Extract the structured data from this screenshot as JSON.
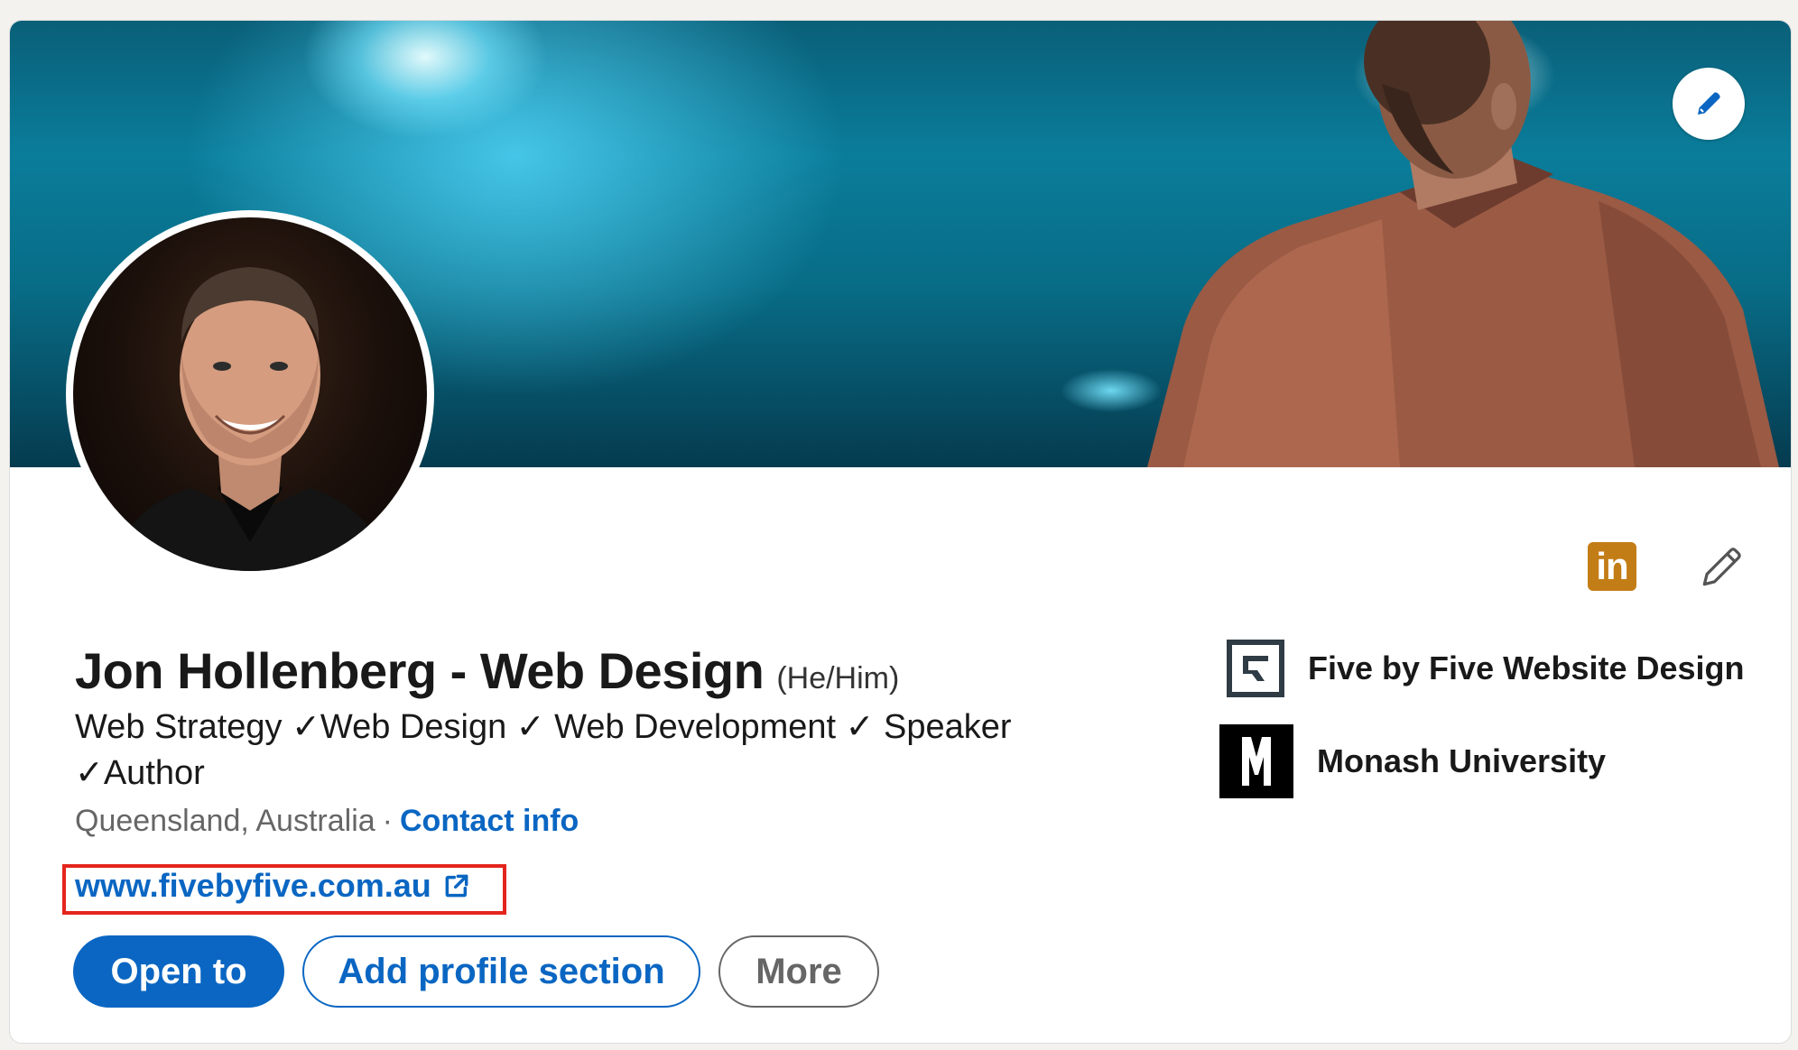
{
  "profile": {
    "name": "Jon Hollenberg - Web Design",
    "pronouns": "(He/Him)",
    "headline": "Web Strategy ✓Web Design ✓ Web Development ✓ Speaker ✓Author",
    "location": "Queensland, Australia",
    "separator": "·",
    "contact_label": "Contact info",
    "website": "www.fivebyfive.com.au"
  },
  "actions": {
    "open_to": "Open to",
    "add_section": "Add profile section",
    "more": "More"
  },
  "organizations": [
    {
      "label": "Five by Five Website Design",
      "logo": "five-by-five-logo"
    },
    {
      "label": "Monash University",
      "logo": "monash-logo"
    }
  ],
  "icons": {
    "banner_edit": "pencil-icon",
    "linkedin_badge": "linkedin-icon",
    "linkedin_text": "in",
    "intro_edit": "pencil-icon",
    "external_link": "external-link-icon"
  },
  "colors": {
    "link_blue": "#0a66c2",
    "highlight_red": "#e4251d",
    "linkedin_badge": "#c37d16",
    "text_dark": "#191919",
    "text_muted": "#666666"
  }
}
